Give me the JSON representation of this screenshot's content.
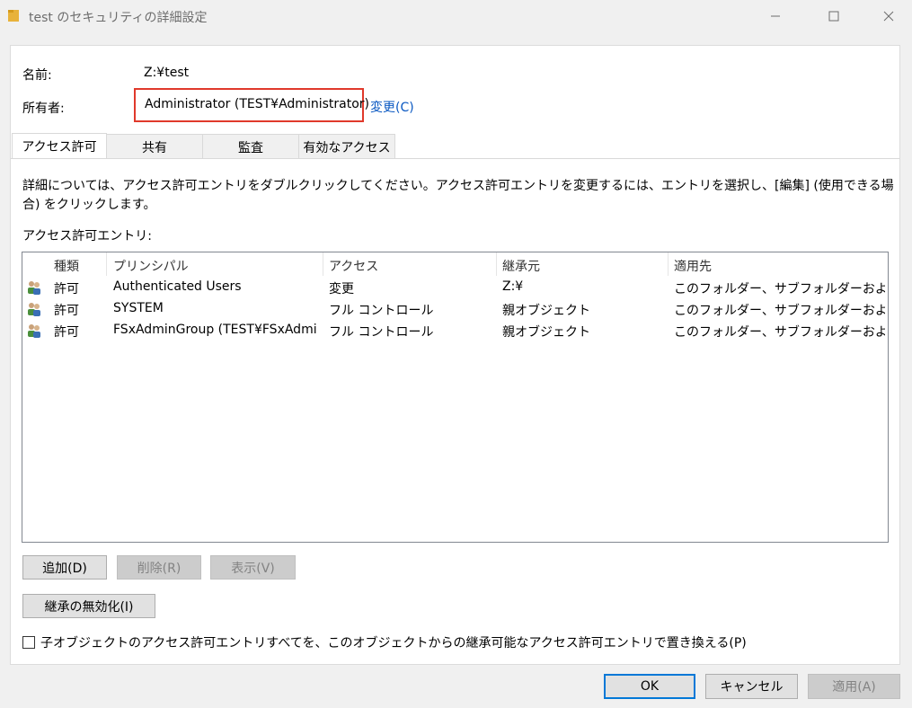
{
  "window": {
    "title": "test のセキュリティの詳細設定",
    "folder_icon": "folder-icon",
    "controls": {
      "minimize_icon": "minimize-icon",
      "maximize_icon": "maximize-icon",
      "close_icon": "close-icon"
    }
  },
  "info": {
    "name_label": "名前:",
    "name_value": "Z:¥test",
    "owner_label": "所有者:",
    "owner_value": "Administrator (TEST¥Administrator)",
    "owner_change_link": "変更(C)",
    "highlight_color": "#e0392b",
    "link_color": "#0a58c2"
  },
  "tabs": [
    {
      "label": "アクセス許可",
      "active": true
    },
    {
      "label": "共有",
      "active": false
    },
    {
      "label": "監査",
      "active": false
    },
    {
      "label": "有効なアクセス",
      "active": false
    }
  ],
  "description": "詳細については、アクセス許可エントリをダブルクリックしてください。アクセス許可エントリを変更するには、エントリを選択し、[編集] (使用できる場合) をクリックします。",
  "entries_label": "アクセス許可エントリ:",
  "table": {
    "columns": [
      "種類",
      "プリンシパル",
      "アクセス",
      "継承元",
      "適用先"
    ],
    "rows": [
      {
        "icon": "users-group-icon",
        "type": "許可",
        "principal": "Authenticated Users",
        "access": "変更",
        "inherited_from": "Z:¥",
        "applies_to": "このフォルダー、サブフォルダーおよびファ..."
      },
      {
        "icon": "users-group-icon",
        "type": "許可",
        "principal": "SYSTEM",
        "access": "フル コントロール",
        "inherited_from": "親オブジェクト",
        "applies_to": "このフォルダー、サブフォルダーおよびファ..."
      },
      {
        "icon": "users-group-icon",
        "type": "許可",
        "principal": "FSxAdminGroup (TEST¥FSxAdmi...",
        "access": "フル コントロール",
        "inherited_from": "親オブジェクト",
        "applies_to": "このフォルダー、サブフォルダーおよびファ..."
      }
    ]
  },
  "buttons": {
    "add": "追加(D)",
    "remove": "削除(R)",
    "view": "表示(V)",
    "disable_inheritance": "継承の無効化(I)",
    "ok": "OK",
    "cancel": "キャンセル",
    "apply": "適用(A)"
  },
  "replace_checkbox": {
    "label": "子オブジェクトのアクセス許可エントリすべてを、このオブジェクトからの継承可能なアクセス許可エントリで置き換える(P)",
    "checked": false
  }
}
